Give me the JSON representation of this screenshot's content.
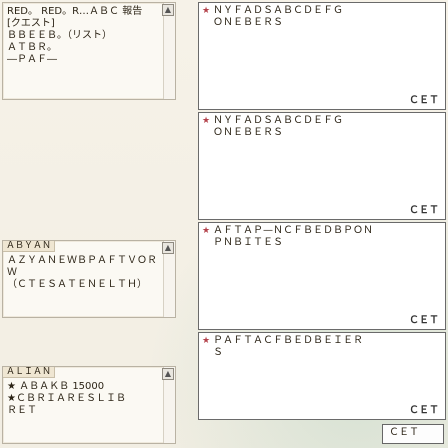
{
  "panels": {
    "top": {
      "text": "RED。 RED。R…ＡＢＣ 報告 [クエスト]\nＢＢＥＥＢ。（リスト）\nＡＴＢＲ。\n―ＰＡＦ―",
      "title": ""
    },
    "middle": {
      "title": "ＡＢＹＡＮ",
      "text": "ＡＺＹＡＮＥＷＢＰＡＦＴＶＯＲＷ\n（ＣＴＥＳＡＴＥＮＥＬＴＨ）"
    },
    "bottom": {
      "title": "ＡＬＩＡＮ",
      "text": "★ ＡＢＡＫＢ 15000\n★ＣＢＲＩＡＲＥＳＬＩＢ\nＲＥＴ"
    }
  },
  "bubbles": [
    {
      "mark": "★",
      "text": "ＮＹＦＡＤＳＡＢＣＤＥＦＧ\nＯＮＥＢＥＲＳ",
      "close": "ＣＥＴ"
    },
    {
      "mark": "★",
      "text": "ＮＹＦＡＤＳＡＢＣＤＥＦＧ\nＯＮＥＢＥＲＳ",
      "close": "ＣＥＴ"
    },
    {
      "mark": "★",
      "text": "ＡＦＴＡＰ—ＮＣＦＢＥＤＢＰＯＮ\nＰＮＢＩＴＥＳ",
      "close": "ＣＥＴ"
    },
    {
      "mark": "★",
      "text": "ＰＡＦＴＡＣＦＢＥＤＢＥＩＥＲ\nＳ",
      "close": "ＣＥＴ"
    }
  ],
  "close_button": "ＣＥＴ"
}
